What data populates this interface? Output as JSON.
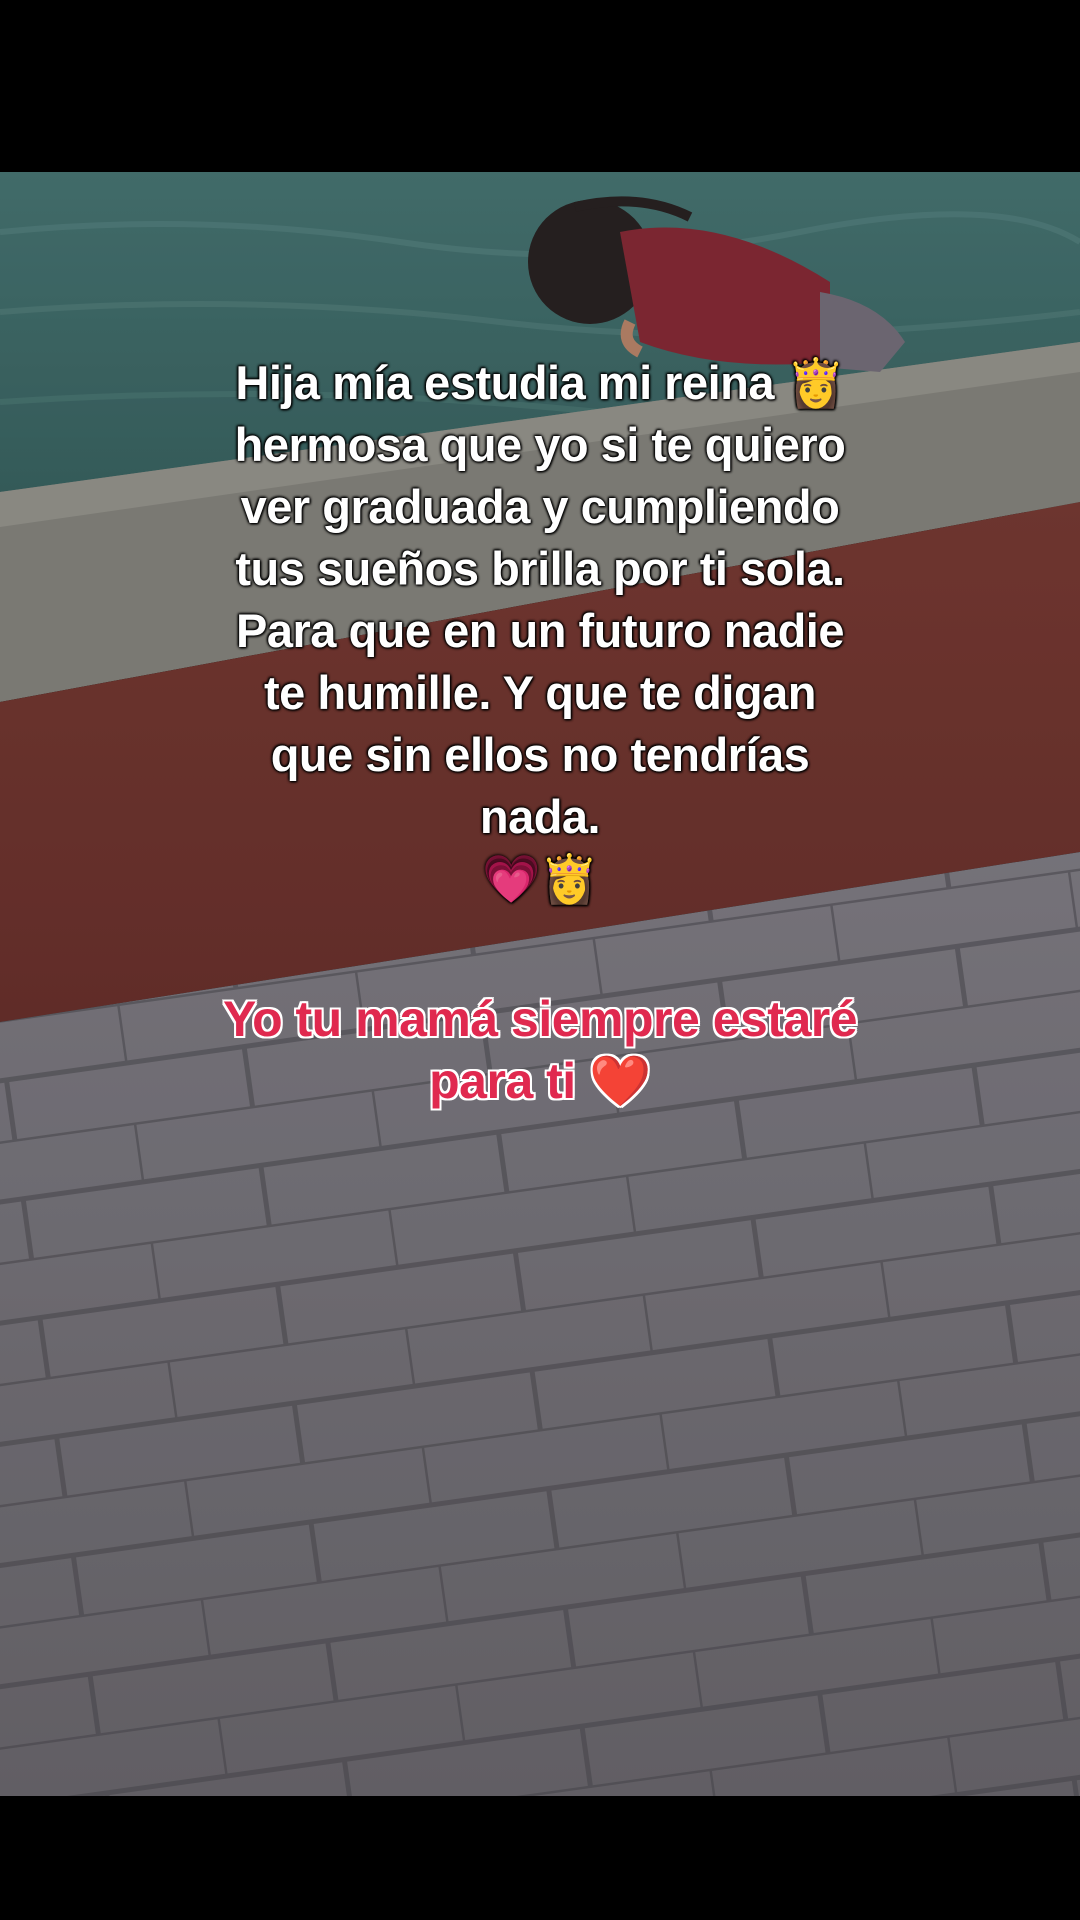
{
  "caption": {
    "lines": [
      "Hija mía estudia mi reina 👸",
      "hermosa que yo si te quiero",
      "ver graduada y cumpliendo",
      "tus sueños brilla por ti sola.",
      "Para que en un futuro nadie",
      "te humille. Y que te digan",
      "que sin ellos no tendrías",
      "nada.",
      "💗👸"
    ]
  },
  "highlight": {
    "lines": [
      "Yo tu mamá siempre estaré",
      "para ti ❤️"
    ],
    "color": "#e0294f"
  },
  "colors": {
    "water": "#3f6e6c",
    "pool_edge": "#8a8a82",
    "red_deck": "#7a3a34",
    "pavers": "#8c8a8c"
  }
}
